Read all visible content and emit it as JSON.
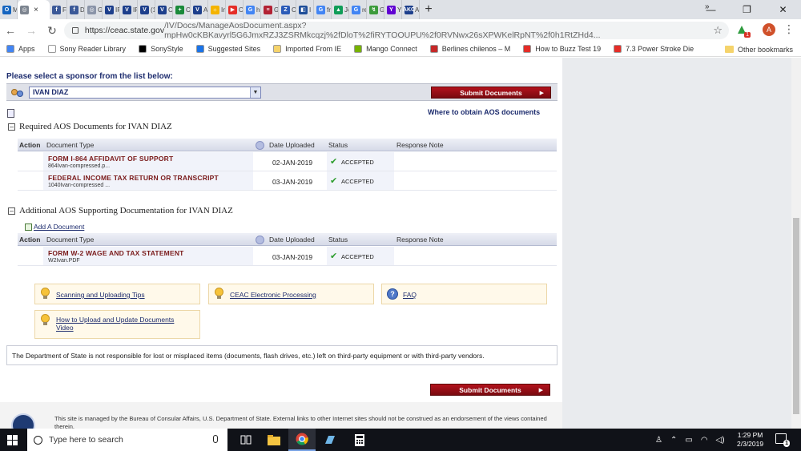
{
  "browser": {
    "tabs": [
      {
        "label": "M",
        "color": "#1565c0",
        "glyph": "O"
      },
      {
        "label": "",
        "color": "#7d8590",
        "glyph": "◎",
        "active": true
      },
      {
        "label": "Fa",
        "color": "#3b5998",
        "glyph": "f"
      },
      {
        "label": "D",
        "color": "#3b5998",
        "glyph": "f"
      },
      {
        "label": "G",
        "color": "#8a94a8",
        "glyph": "◎"
      },
      {
        "label": "IR",
        "color": "#1d3f8c",
        "glyph": "V"
      },
      {
        "label": "IR",
        "color": "#1d3f8c",
        "glyph": "V"
      },
      {
        "label": "(1",
        "color": "#1d3f8c",
        "glyph": "V"
      },
      {
        "label": "C",
        "color": "#1d3f8c",
        "glyph": "V"
      },
      {
        "label": "C",
        "color": "#1a8a3a",
        "glyph": "+"
      },
      {
        "label": "A",
        "color": "#1d3f8c",
        "glyph": "V"
      },
      {
        "label": "In",
        "color": "#f4b400",
        "glyph": "☼"
      },
      {
        "label": "C",
        "color": "#e52d27",
        "glyph": "▶"
      },
      {
        "label": "hi",
        "color": "#4285f4",
        "glyph": "G"
      },
      {
        "label": "G",
        "color": "#b22234",
        "glyph": "≡"
      },
      {
        "label": "C",
        "color": "#2b5bb8",
        "glyph": "Z"
      },
      {
        "label": "I I",
        "color": "#1f4e99",
        "glyph": "◧"
      },
      {
        "label": "fr",
        "color": "#4285f4",
        "glyph": "G"
      },
      {
        "label": "Jc",
        "color": "#0f9d58",
        "glyph": "▲"
      },
      {
        "label": "re",
        "color": "#4285f4",
        "glyph": "G"
      },
      {
        "label": "G",
        "color": "#3c9b3c",
        "glyph": "↯"
      },
      {
        "label": "Yc",
        "color": "#6001d2",
        "glyph": "Y"
      },
      {
        "label": "A",
        "color": "#1d3f8c",
        "glyph": "AKC"
      }
    ],
    "new_tab": "+",
    "window_controls": {
      "minimize": "—",
      "restore": "❐",
      "close": "✕"
    },
    "url_main": "https://ceac.state.gov",
    "url_rest": "/IV/Docs/ManageAosDocument.aspx?mpHw0cKBKavyrl5G6JmxRZJ3ZSRMkcqzj%2fDloT%2fiRYTOOUPU%2f0RVNwx26sXPWKelRpNT%2f0h1RtZHd4...",
    "extension_badge": "1",
    "profile_initial": "A",
    "bookmarks": [
      {
        "label": "Apps",
        "color": "#4285f4"
      },
      {
        "label": "Sony Reader Library",
        "color": "#ffffff"
      },
      {
        "label": "SonyStyle",
        "color": "#000000"
      },
      {
        "label": "Suggested Sites",
        "color": "#1a73e8"
      },
      {
        "label": "Imported From IE",
        "color": "#f5d36b"
      },
      {
        "label": "Mango Connect",
        "color": "#77b300"
      },
      {
        "label": "Berlines chilenos – M",
        "color": "#c62828"
      },
      {
        "label": "How to Buzz Test 19",
        "color": "#e52d27"
      },
      {
        "label": "7.3 Power Stroke Die",
        "color": "#e52d27"
      }
    ],
    "bookmarks_more": "»",
    "other_bookmarks": "Other bookmarks"
  },
  "page": {
    "select_sponsor_prompt": "Please select a sponsor from the list below:",
    "sponsor_selected": "IVAN DIAZ",
    "submit_label": "Submit Documents",
    "where_link": "Where to obtain AOS documents",
    "required_section_title": "Required AOS Documents for IVAN DIAZ",
    "additional_section_title": "Additional AOS Supporting Documentation for IVAN DIAZ",
    "columns": {
      "action": "Action",
      "type": "Document Type",
      "date": "Date Uploaded",
      "status": "Status",
      "note": "Response Note"
    },
    "required_docs": [
      {
        "type": "FORM I-864 AFFIDAVIT OF SUPPORT",
        "file": "864Ivan-compressed.p...",
        "date": "02-JAN-2019",
        "status": "ACCEPTED"
      },
      {
        "type": "FEDERAL INCOME TAX RETURN OR TRANSCRIPT",
        "file": "1040Ivan-compressed ...",
        "date": "03-JAN-2019",
        "status": "ACCEPTED"
      }
    ],
    "add_document": "Add A Document",
    "additional_docs": [
      {
        "type": "FORM W-2 WAGE AND TAX STATEMENT",
        "file": "W2Ivan.PDF",
        "date": "03-JAN-2019",
        "status": "ACCEPTED"
      }
    ],
    "help_links": {
      "scanning": "Scanning and Uploading Tips",
      "ceac": "CEAC Electronic Processing",
      "faq": "FAQ",
      "video": "How to Upload and Update Documents Video"
    },
    "disclaimer": "The Department of State is not responsible for lost or misplaced items (documents, flash drives, etc.) left on third-party equipment or with third-party vendors.",
    "footer_text": "This site is managed by the Bureau of Consular Affairs, U.S. Department of State. External links to other Internet sites should not be construed as an endorsement of the views contained therein."
  },
  "taskbar": {
    "search_placeholder": "Type here to search",
    "time": "1:29 PM",
    "date": "2/3/2019",
    "notification_count": "1"
  }
}
